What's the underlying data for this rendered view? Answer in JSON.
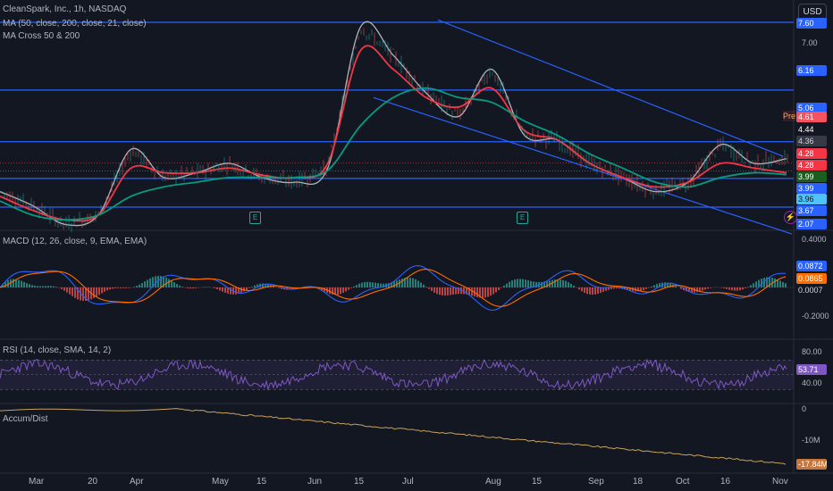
{
  "header": {
    "symbol": "CleanSpark, Inc., 1h, NASDAQ",
    "ind1": "MA (50, close, 200, close, 21, close)",
    "ind2": "MA Cross 50 & 200",
    "currency": "USD",
    "pre": "Pre"
  },
  "colors": {
    "bg": "#131722",
    "level": "#2962ff",
    "ma_fast": "#f23645",
    "ma_slow": "#089981",
    "price": "#b2b5be",
    "macd": "#2962ff",
    "signal": "#ff6d00",
    "rsi": "#7e57c2",
    "accum": "#c8a25a"
  },
  "price_axis": [
    "7.00"
  ],
  "price_tags": [
    {
      "value": "7.60",
      "bg": "#2962ff",
      "fg": "#ffffff"
    },
    {
      "value": "6.16",
      "bg": "#2962ff",
      "fg": "#ffffff"
    },
    {
      "value": "5.06",
      "bg": "#2962ff",
      "fg": "#ffffff"
    },
    {
      "value": "4.61",
      "bg": "#f7525f",
      "fg": "#ffffff"
    },
    {
      "value": "4.44",
      "bg": "#131722",
      "fg": "#ffffff"
    },
    {
      "value": "4.36",
      "bg": "#363a45",
      "fg": "#d1d4dc"
    },
    {
      "value": "4.28",
      "bg": "#f23645",
      "fg": "#ffffff"
    },
    {
      "value": "4.28",
      "bg": "#f23645",
      "fg": "#ffffff"
    },
    {
      "value": "3.99",
      "bg": "#1b5e20",
      "fg": "#ffffff"
    },
    {
      "value": "3.99",
      "bg": "#2962ff",
      "fg": "#ffffff"
    },
    {
      "value": "3.96",
      "bg": "#4fc3f7",
      "fg": "#131722"
    },
    {
      "value": "3.67",
      "bg": "#2962ff",
      "fg": "#ffffff"
    },
    {
      "value": "2.07",
      "bg": "#2962ff",
      "fg": "#ffffff"
    }
  ],
  "macd": {
    "title": "MACD (12, 26, close, 9, EMA, EMA)",
    "axis_top": "0.4000",
    "axis_bottom": "-0.2000",
    "tags": [
      {
        "value": "0.0872",
        "bg": "#2962ff",
        "fg": "#ffffff"
      },
      {
        "value": "0.0865",
        "bg": "#ff6d00",
        "fg": "#ffffff"
      },
      {
        "value": "0.0007",
        "bg": "#131722",
        "fg": "#d1d4dc"
      }
    ]
  },
  "rsi": {
    "title": "RSI (14, close, SMA, 14, 2)",
    "axis_top": "80.00",
    "axis_bottom": "40.00",
    "tag": {
      "value": "53.71",
      "bg": "#7e57c2",
      "fg": "#ffffff"
    },
    "upper": 70,
    "lower": 30
  },
  "accum": {
    "title": "Accum/Dist",
    "axis_top": "0",
    "axis_mid": "-10M",
    "tag": {
      "value": "-17.84M",
      "bg": "#c8753a",
      "fg": "#ffffff"
    }
  },
  "x_labels": [
    "Mar",
    "20",
    "Apr",
    "May",
    "15",
    "Jun",
    "15",
    "Jul",
    "Aug",
    "15",
    "Sep",
    "18",
    "Oct",
    "16",
    "Nov"
  ],
  "earnings_marker": "E",
  "chart_data": {
    "type": "line",
    "title": "CleanSpark, Inc., 1h, NASDAQ",
    "x": [
      "Mar",
      "20",
      "Apr",
      "May",
      "15",
      "Jun",
      "15",
      "Jul",
      "Aug",
      "15",
      "Sep",
      "18",
      "Oct",
      "16",
      "Nov"
    ],
    "ylim": [
      2.07,
      7.6
    ],
    "horizontal_levels": [
      7.6,
      6.16,
      5.06,
      4.28,
      3.67
    ],
    "series": [
      {
        "values": [
          4.0,
          3.7,
          3.3,
          3.5,
          4.9,
          4.3,
          4.4,
          4.6,
          4.3,
          4.2,
          4.5,
          7.5,
          6.9,
          6.1,
          5.6,
          6.6,
          5.2,
          5.1,
          4.6,
          4.3,
          4.0,
          4.2,
          5.0,
          4.6,
          4.7
        ]
      },
      {
        "values": [
          3.9,
          3.6,
          3.4,
          3.5,
          4.5,
          4.4,
          4.4,
          4.5,
          4.35,
          4.3,
          4.6,
          7.0,
          6.6,
          6.0,
          5.8,
          6.2,
          5.3,
          5.1,
          4.6,
          4.3,
          4.1,
          4.2,
          4.6,
          4.5,
          4.4
        ]
      },
      {
        "values": [
          3.8,
          3.5,
          3.4,
          3.5,
          3.9,
          4.1,
          4.2,
          4.3,
          4.3,
          4.3,
          4.45,
          5.4,
          6.0,
          6.2,
          6.0,
          5.9,
          5.5,
          5.2,
          4.8,
          4.5,
          4.2,
          4.1,
          4.3,
          4.4,
          4.36
        ]
      }
    ]
  }
}
